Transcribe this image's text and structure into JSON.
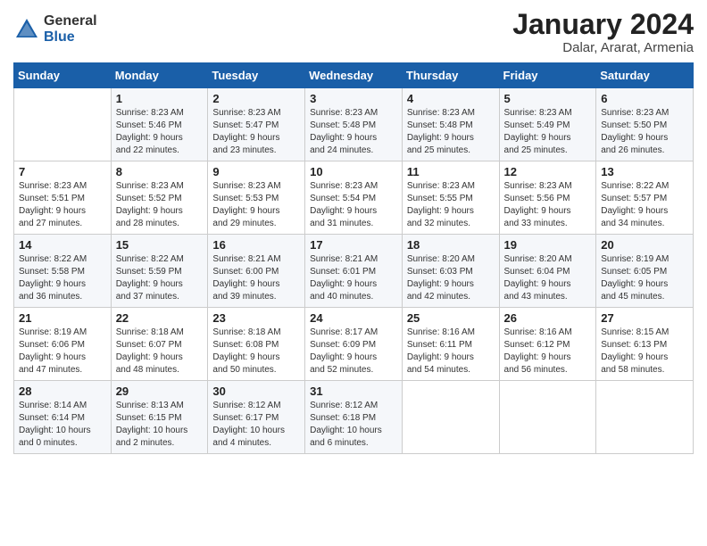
{
  "header": {
    "logo_general": "General",
    "logo_blue": "Blue",
    "main_title": "January 2024",
    "subtitle": "Dalar, Ararat, Armenia"
  },
  "calendar": {
    "days_of_week": [
      "Sunday",
      "Monday",
      "Tuesday",
      "Wednesday",
      "Thursday",
      "Friday",
      "Saturday"
    ],
    "weeks": [
      [
        {
          "day": "",
          "info": ""
        },
        {
          "day": "1",
          "info": "Sunrise: 8:23 AM\nSunset: 5:46 PM\nDaylight: 9 hours\nand 22 minutes."
        },
        {
          "day": "2",
          "info": "Sunrise: 8:23 AM\nSunset: 5:47 PM\nDaylight: 9 hours\nand 23 minutes."
        },
        {
          "day": "3",
          "info": "Sunrise: 8:23 AM\nSunset: 5:48 PM\nDaylight: 9 hours\nand 24 minutes."
        },
        {
          "day": "4",
          "info": "Sunrise: 8:23 AM\nSunset: 5:48 PM\nDaylight: 9 hours\nand 25 minutes."
        },
        {
          "day": "5",
          "info": "Sunrise: 8:23 AM\nSunset: 5:49 PM\nDaylight: 9 hours\nand 25 minutes."
        },
        {
          "day": "6",
          "info": "Sunrise: 8:23 AM\nSunset: 5:50 PM\nDaylight: 9 hours\nand 26 minutes."
        }
      ],
      [
        {
          "day": "7",
          "info": "Sunrise: 8:23 AM\nSunset: 5:51 PM\nDaylight: 9 hours\nand 27 minutes."
        },
        {
          "day": "8",
          "info": "Sunrise: 8:23 AM\nSunset: 5:52 PM\nDaylight: 9 hours\nand 28 minutes."
        },
        {
          "day": "9",
          "info": "Sunrise: 8:23 AM\nSunset: 5:53 PM\nDaylight: 9 hours\nand 29 minutes."
        },
        {
          "day": "10",
          "info": "Sunrise: 8:23 AM\nSunset: 5:54 PM\nDaylight: 9 hours\nand 31 minutes."
        },
        {
          "day": "11",
          "info": "Sunrise: 8:23 AM\nSunset: 5:55 PM\nDaylight: 9 hours\nand 32 minutes."
        },
        {
          "day": "12",
          "info": "Sunrise: 8:23 AM\nSunset: 5:56 PM\nDaylight: 9 hours\nand 33 minutes."
        },
        {
          "day": "13",
          "info": "Sunrise: 8:22 AM\nSunset: 5:57 PM\nDaylight: 9 hours\nand 34 minutes."
        }
      ],
      [
        {
          "day": "14",
          "info": "Sunrise: 8:22 AM\nSunset: 5:58 PM\nDaylight: 9 hours\nand 36 minutes."
        },
        {
          "day": "15",
          "info": "Sunrise: 8:22 AM\nSunset: 5:59 PM\nDaylight: 9 hours\nand 37 minutes."
        },
        {
          "day": "16",
          "info": "Sunrise: 8:21 AM\nSunset: 6:00 PM\nDaylight: 9 hours\nand 39 minutes."
        },
        {
          "day": "17",
          "info": "Sunrise: 8:21 AM\nSunset: 6:01 PM\nDaylight: 9 hours\nand 40 minutes."
        },
        {
          "day": "18",
          "info": "Sunrise: 8:20 AM\nSunset: 6:03 PM\nDaylight: 9 hours\nand 42 minutes."
        },
        {
          "day": "19",
          "info": "Sunrise: 8:20 AM\nSunset: 6:04 PM\nDaylight: 9 hours\nand 43 minutes."
        },
        {
          "day": "20",
          "info": "Sunrise: 8:19 AM\nSunset: 6:05 PM\nDaylight: 9 hours\nand 45 minutes."
        }
      ],
      [
        {
          "day": "21",
          "info": "Sunrise: 8:19 AM\nSunset: 6:06 PM\nDaylight: 9 hours\nand 47 minutes."
        },
        {
          "day": "22",
          "info": "Sunrise: 8:18 AM\nSunset: 6:07 PM\nDaylight: 9 hours\nand 48 minutes."
        },
        {
          "day": "23",
          "info": "Sunrise: 8:18 AM\nSunset: 6:08 PM\nDaylight: 9 hours\nand 50 minutes."
        },
        {
          "day": "24",
          "info": "Sunrise: 8:17 AM\nSunset: 6:09 PM\nDaylight: 9 hours\nand 52 minutes."
        },
        {
          "day": "25",
          "info": "Sunrise: 8:16 AM\nSunset: 6:11 PM\nDaylight: 9 hours\nand 54 minutes."
        },
        {
          "day": "26",
          "info": "Sunrise: 8:16 AM\nSunset: 6:12 PM\nDaylight: 9 hours\nand 56 minutes."
        },
        {
          "day": "27",
          "info": "Sunrise: 8:15 AM\nSunset: 6:13 PM\nDaylight: 9 hours\nand 58 minutes."
        }
      ],
      [
        {
          "day": "28",
          "info": "Sunrise: 8:14 AM\nSunset: 6:14 PM\nDaylight: 10 hours\nand 0 minutes."
        },
        {
          "day": "29",
          "info": "Sunrise: 8:13 AM\nSunset: 6:15 PM\nDaylight: 10 hours\nand 2 minutes."
        },
        {
          "day": "30",
          "info": "Sunrise: 8:12 AM\nSunset: 6:17 PM\nDaylight: 10 hours\nand 4 minutes."
        },
        {
          "day": "31",
          "info": "Sunrise: 8:12 AM\nSunset: 6:18 PM\nDaylight: 10 hours\nand 6 minutes."
        },
        {
          "day": "",
          "info": ""
        },
        {
          "day": "",
          "info": ""
        },
        {
          "day": "",
          "info": ""
        }
      ]
    ]
  }
}
